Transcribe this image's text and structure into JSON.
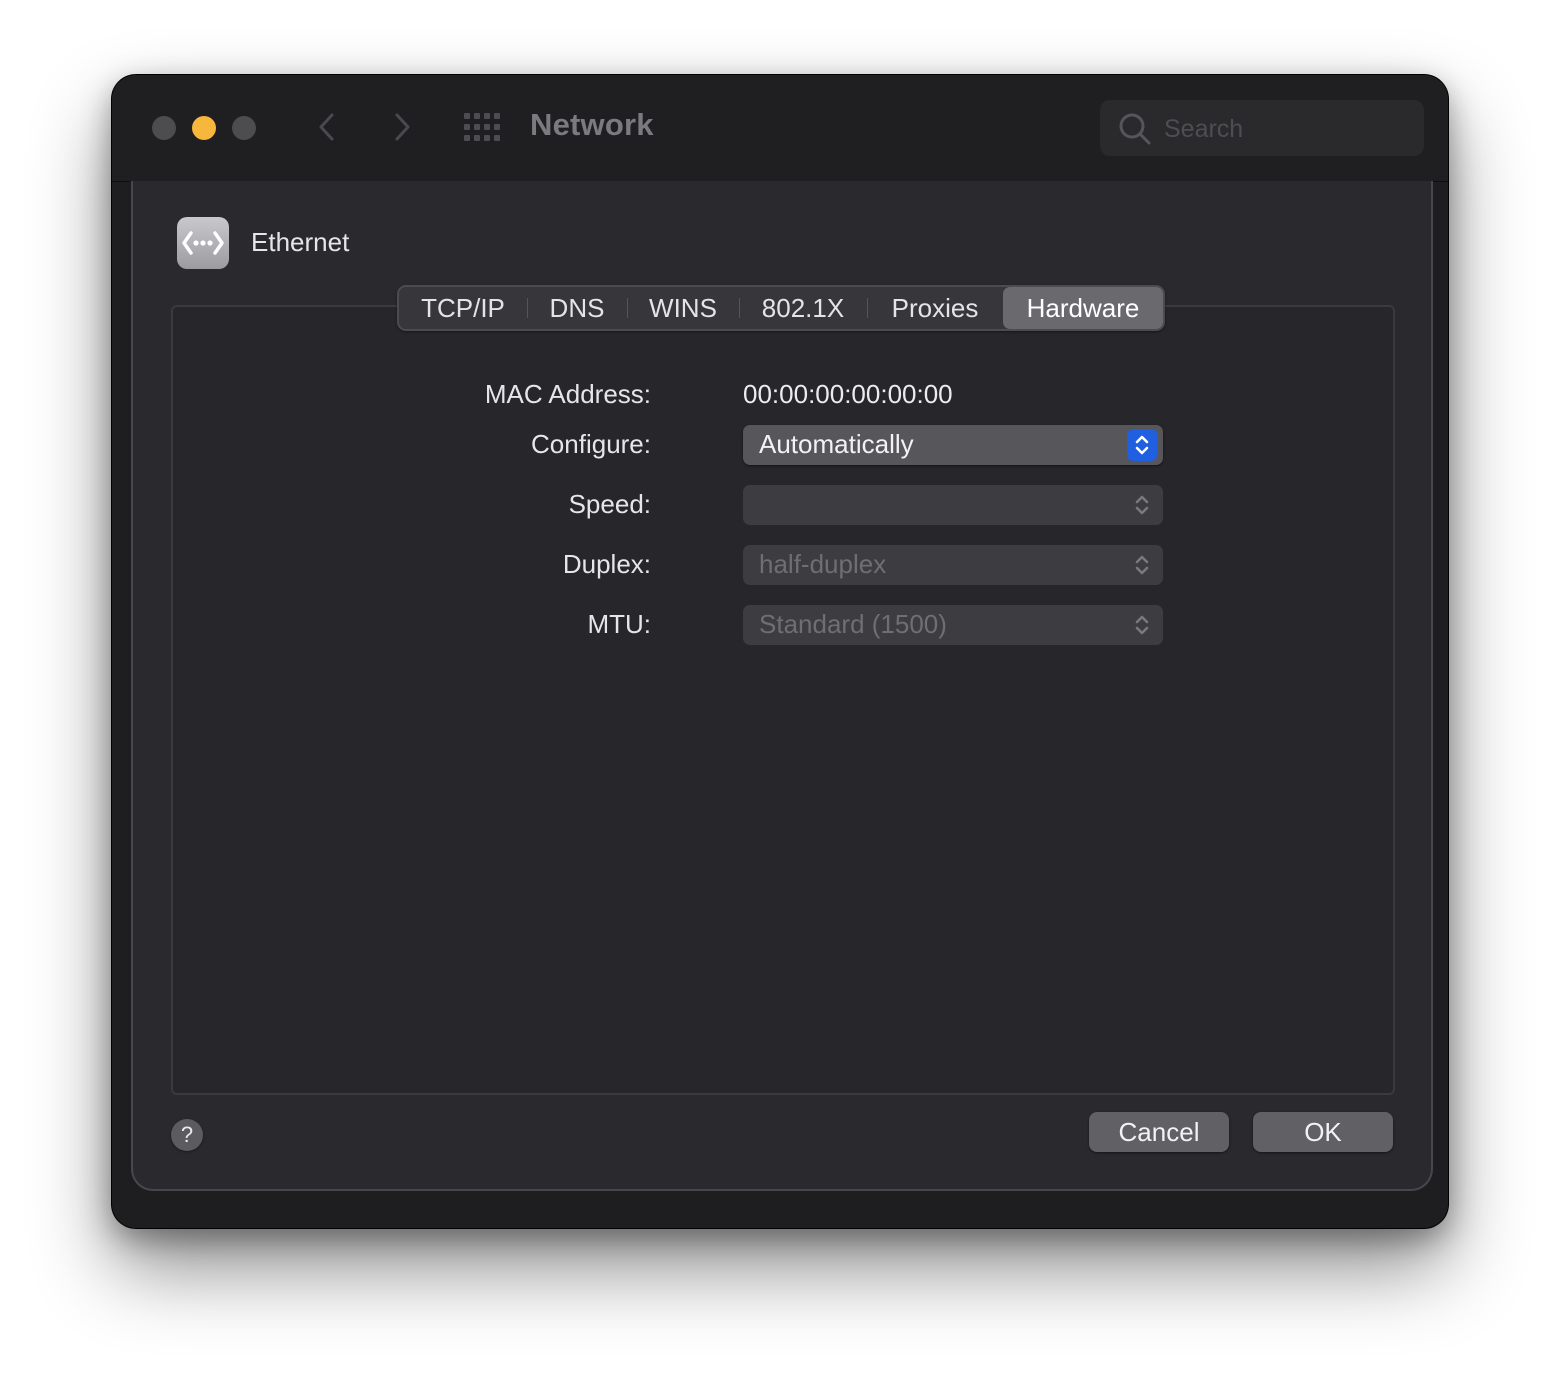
{
  "window": {
    "title": "Network"
  },
  "search": {
    "placeholder": "Search"
  },
  "interface": {
    "name": "Ethernet",
    "icon": "ethernet-icon"
  },
  "tabs": [
    {
      "label": "TCP/IP",
      "selected": false
    },
    {
      "label": "DNS",
      "selected": false
    },
    {
      "label": "WINS",
      "selected": false
    },
    {
      "label": "802.1X",
      "selected": false
    },
    {
      "label": "Proxies",
      "selected": false
    },
    {
      "label": "Hardware",
      "selected": true
    }
  ],
  "hardware": {
    "mac_label": "MAC Address:",
    "mac_value": "00:00:00:00:00:00",
    "configure_label": "Configure:",
    "configure_value": "Automatically",
    "speed_label": "Speed:",
    "speed_value": "",
    "duplex_label": "Duplex:",
    "duplex_value": "half-duplex",
    "mtu_label": "MTU:",
    "mtu_value": "Standard (1500)"
  },
  "buttons": {
    "help": "?",
    "cancel": "Cancel",
    "ok": "OK"
  },
  "colors": {
    "accent": "#1f5fe0",
    "minimize": "#f6b73c",
    "window_bg": "#1e1e20"
  }
}
